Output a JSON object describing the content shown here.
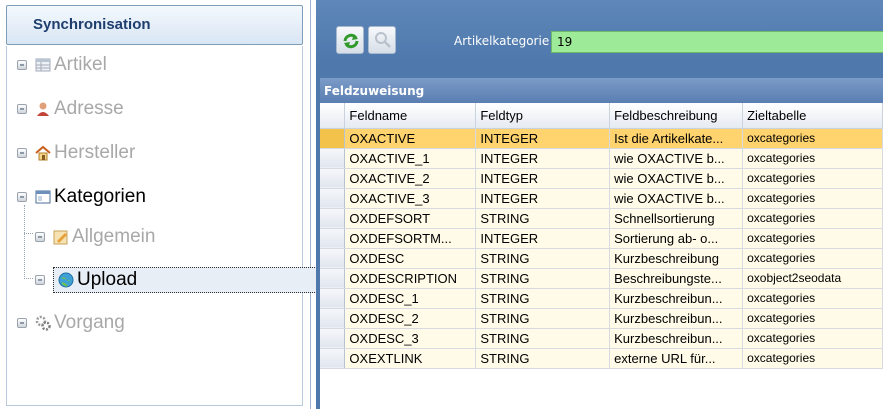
{
  "nav": {
    "title": "Synchronisation",
    "items": [
      {
        "label": "Artikel",
        "icon": "table-icon",
        "state": "disabled"
      },
      {
        "label": "Adresse",
        "icon": "person-icon",
        "state": "disabled"
      },
      {
        "label": "Hersteller",
        "icon": "house-icon",
        "state": "disabled"
      },
      {
        "label": "Kategorien",
        "icon": "window-icon",
        "state": "active"
      },
      {
        "label": "Allgemein",
        "icon": "pencil-icon",
        "state": "disabled"
      },
      {
        "label": "Upload",
        "icon": "globe-icon",
        "state": "selected"
      },
      {
        "label": "Vorgang",
        "icon": "gears-icon",
        "state": "disabled"
      }
    ]
  },
  "toolbar": {
    "refresh_icon": "refresh-icon",
    "search_icon": "search-icon",
    "category_label": "Artikelkategorie",
    "category_value": "19"
  },
  "grid": {
    "title": "Feldzuweisung",
    "columns": [
      "Feldname",
      "Feldtyp",
      "Feldbeschreibung",
      "Zieltabelle"
    ],
    "rows": [
      {
        "feldname": "OXACTIVE",
        "feldtyp": "INTEGER",
        "beschreibung": "Ist die Artikelkate...",
        "ziel": "oxcategories",
        "selected": true
      },
      {
        "feldname": "OXACTIVE_1",
        "feldtyp": "INTEGER",
        "beschreibung": "wie OXACTIVE b...",
        "ziel": "oxcategories"
      },
      {
        "feldname": "OXACTIVE_2",
        "feldtyp": "INTEGER",
        "beschreibung": "wie OXACTIVE b...",
        "ziel": "oxcategories"
      },
      {
        "feldname": "OXACTIVE_3",
        "feldtyp": "INTEGER",
        "beschreibung": "wie OXACTIVE b...",
        "ziel": "oxcategories"
      },
      {
        "feldname": "OXDEFSORT",
        "feldtyp": "STRING",
        "beschreibung": "Schnellsortierung",
        "ziel": "oxcategories"
      },
      {
        "feldname": "OXDEFSORTM...",
        "feldtyp": "INTEGER",
        "beschreibung": "Sortierung ab- o...",
        "ziel": "oxcategories"
      },
      {
        "feldname": "OXDESC",
        "feldtyp": "STRING",
        "beschreibung": "Kurzbeschreibung",
        "ziel": "oxcategories"
      },
      {
        "feldname": "OXDESCRIPTION",
        "feldtyp": "STRING",
        "beschreibung": "Beschreibungste...",
        "ziel": "oxobject2seodata"
      },
      {
        "feldname": "OXDESC_1",
        "feldtyp": "STRING",
        "beschreibung": "Kurzbeschreibun...",
        "ziel": "oxcategories"
      },
      {
        "feldname": "OXDESC_2",
        "feldtyp": "STRING",
        "beschreibung": "Kurzbeschreibun...",
        "ziel": "oxcategories"
      },
      {
        "feldname": "OXDESC_3",
        "feldtyp": "STRING",
        "beschreibung": "Kurzbeschreibun...",
        "ziel": "oxcategories"
      },
      {
        "feldname": "OXEXTLINK",
        "feldtyp": "STRING",
        "beschreibung": "externe URL für...",
        "ziel": "oxcategories"
      }
    ]
  }
}
